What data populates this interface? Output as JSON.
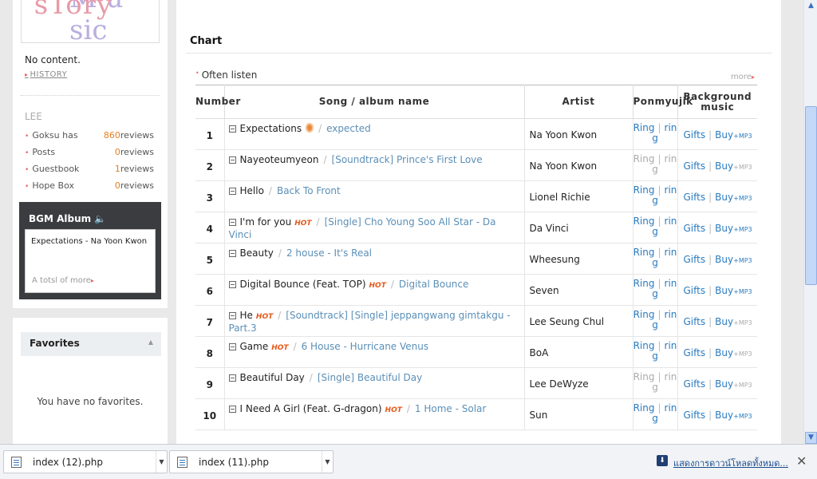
{
  "sidebar": {
    "logo_text": "Music Story",
    "no_content": "No content.",
    "history": "HISTORY",
    "owner": "LEE",
    "stats": [
      {
        "label": "Goksu has",
        "count": "860",
        "unit": "reviews"
      },
      {
        "label": "Posts",
        "count": "0",
        "unit": "reviews"
      },
      {
        "label": "Guestbook",
        "count": "1",
        "unit": "reviews"
      },
      {
        "label": "Hope Box",
        "count": "0",
        "unit": "reviews"
      }
    ],
    "bgm": {
      "title": "BGM Album",
      "song": "Expectations - Na Yoon Kwon",
      "more": "A totsl of more"
    },
    "favorites": {
      "title": "Favorites",
      "empty": "You have no favorites."
    }
  },
  "main": {
    "title": "Chart",
    "often_listen": "Often listen",
    "more": "more",
    "headers": {
      "number": "Number",
      "song": "Song / album name",
      "artist": "Artist",
      "ring": "Ponmyujik",
      "bg": "Background music"
    },
    "ring_labels": {
      "ring": "Ring",
      "rin": "rin",
      "g": "g"
    },
    "bg_labels": {
      "gifts": "Gifts",
      "buy": "Buy",
      "mp3": "+MP3"
    },
    "rows": [
      {
        "num": "1",
        "song": "Expectations",
        "hot": "",
        "medal": true,
        "album": "expected",
        "artist": "Na Yoon Kwon"
      },
      {
        "num": "2",
        "song": "Nayeoteumyeon",
        "hot": "",
        "medal": false,
        "album": "[Soundtrack] Prince's First Love",
        "artist": "Na Yoon Kwon"
      },
      {
        "num": "3",
        "song": "Hello",
        "hot": "",
        "medal": false,
        "album": "Back To Front",
        "artist": "Lionel Richie"
      },
      {
        "num": "4",
        "song": "I'm for you",
        "hot": "HOT",
        "medal": false,
        "album": "[Single] Cho Young Soo All Star - Da Vinci",
        "artist": "Da Vinci"
      },
      {
        "num": "5",
        "song": "Beauty",
        "hot": "",
        "medal": false,
        "album": "2 house - It's Real",
        "artist": "Wheesung"
      },
      {
        "num": "6",
        "song": "Digital Bounce (Feat. TOP)",
        "hot": "HOT",
        "medal": false,
        "album": "Digital Bounce",
        "artist": "Seven"
      },
      {
        "num": "7",
        "song": "He",
        "hot": "HOT",
        "medal": false,
        "album": "[Soundtrack] [Single] jeppangwang gimtakgu - Part.3",
        "artist": "Lee Seung Chul"
      },
      {
        "num": "8",
        "song": "Game",
        "hot": "HOT",
        "medal": false,
        "album": "6 House - Hurricane Venus",
        "artist": "BoA"
      },
      {
        "num": "9",
        "song": "Beautiful Day",
        "hot": "",
        "medal": false,
        "album": "[Single] Beautiful Day",
        "artist": "Lee DeWyze"
      },
      {
        "num": "10",
        "song": "I Need A Girl (Feat. G-dragon)",
        "hot": "HOT",
        "medal": false,
        "album": "1 Home - Solar",
        "artist": "Sun"
      }
    ]
  },
  "downloads": {
    "files": [
      "index (12).php",
      "index (11).php"
    ],
    "show_all": "แสดงการดาวน์โหลดทั้งหมด..."
  },
  "colors": {
    "link_blue": "#2a7bbf",
    "album_blue": "#5b8fb7",
    "hot_orange": "#e65a1a",
    "count_orange": "#e67e22",
    "bgm_dark": "#3a3c3f"
  }
}
